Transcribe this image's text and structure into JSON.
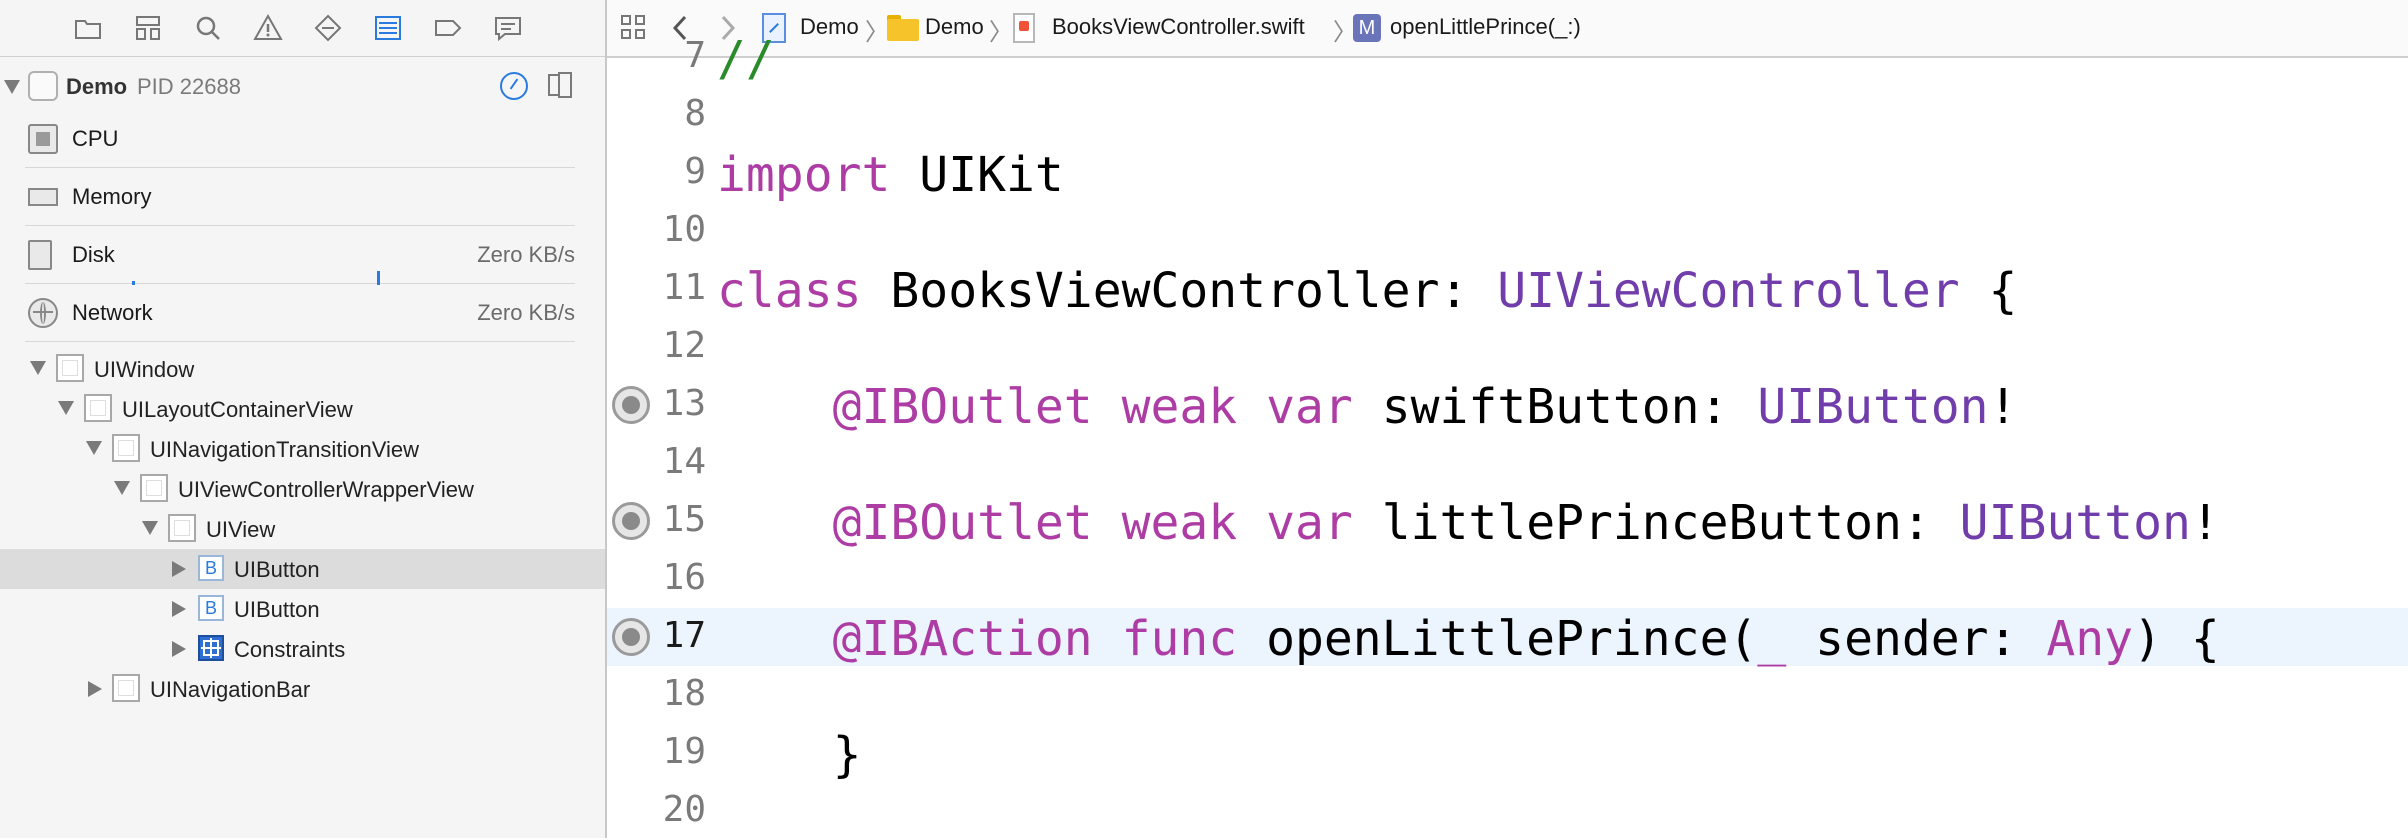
{
  "navigator": {
    "toolbar_icons": [
      "folder-icon",
      "hierarchy-icon",
      "search-icon",
      "warning-icon",
      "test-diamond-icon",
      "debug-list-icon",
      "breakpoint-tag-icon",
      "report-bubble-icon"
    ],
    "process": {
      "name": "Demo",
      "pid": "PID 22688"
    },
    "gauges": [
      {
        "label": "CPU",
        "value": ""
      },
      {
        "label": "Memory",
        "value": ""
      },
      {
        "label": "Disk",
        "value": "Zero KB/s"
      },
      {
        "label": "Network",
        "value": "Zero KB/s"
      }
    ],
    "tree": [
      {
        "label": "UIWindow",
        "kind": "view",
        "expanded": true
      },
      {
        "label": "UILayoutContainerView",
        "kind": "view",
        "expanded": true
      },
      {
        "label": "UINavigationTransitionView",
        "kind": "view",
        "expanded": true
      },
      {
        "label": "UIViewControllerWrapperView",
        "kind": "view",
        "expanded": true
      },
      {
        "label": "UIView",
        "kind": "view",
        "expanded": true
      },
      {
        "label": "UIButton",
        "kind": "button",
        "expanded": false,
        "selected": true,
        "badge": "B"
      },
      {
        "label": "UIButton",
        "kind": "button",
        "expanded": false,
        "badge": "B"
      },
      {
        "label": "Constraints",
        "kind": "constraints",
        "expanded": false
      },
      {
        "label": "UINavigationBar",
        "kind": "view",
        "expanded": false
      }
    ]
  },
  "jumpbar": {
    "items": [
      "Demo",
      "Demo",
      "BooksViewController.swift",
      "openLittlePrince(_:)"
    ],
    "method_badge": "M"
  },
  "editor": {
    "lines": [
      {
        "num": "7",
        "text": "//"
      },
      {
        "num": "8",
        "text": ""
      },
      {
        "num": "9",
        "text": "import UIKit"
      },
      {
        "num": "10",
        "text": ""
      },
      {
        "num": "11",
        "text": "class BooksViewController: UIViewController {"
      },
      {
        "num": "12",
        "text": ""
      },
      {
        "num": "13",
        "text": "    @IBOutlet weak var swiftButton: UIButton!"
      },
      {
        "num": "14",
        "text": ""
      },
      {
        "num": "15",
        "text": "    @IBOutlet weak var littlePrinceButton: UIButton!"
      },
      {
        "num": "16",
        "text": ""
      },
      {
        "num": "17",
        "text": "    @IBAction func openLittlePrince(_ sender: Any) {"
      },
      {
        "num": "18",
        "text": ""
      },
      {
        "num": "19",
        "text": "    }"
      },
      {
        "num": "20",
        "text": ""
      }
    ],
    "highlighted_line": "17",
    "connection_lines": [
      "13",
      "15",
      "17"
    ]
  },
  "colors": {
    "keyword": "#ad3da4",
    "type": "#703daa",
    "comment": "#2a8b2a",
    "current_line": "#ecf5fe",
    "accent": "#2a7be0"
  }
}
